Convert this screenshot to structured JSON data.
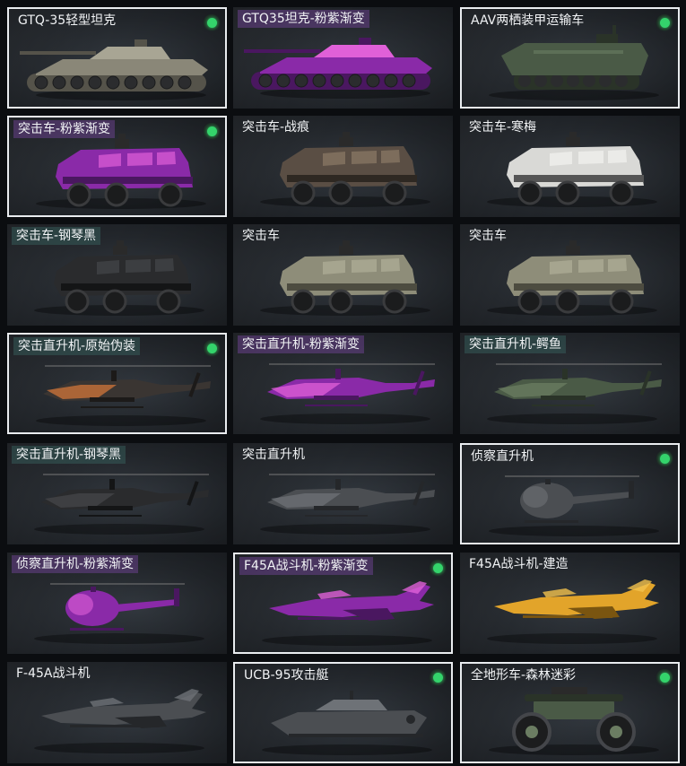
{
  "colors": {
    "accent_green": "#34d36b",
    "selected_border": "#e9ecef",
    "card_bg": "#2a2e33"
  },
  "items": [
    {
      "label": "GTQ-35轻型坦克",
      "type": "tank",
      "skin": "camo",
      "owned": true,
      "selected": true,
      "tint": "none"
    },
    {
      "label": "GTQ35坦克-粉紫渐变",
      "type": "tank",
      "skin": "pink",
      "owned": false,
      "selected": false,
      "tint": "purple"
    },
    {
      "label": "AAV两栖装甲运输车",
      "type": "aav",
      "skin": "green",
      "owned": true,
      "selected": true,
      "tint": "none"
    },
    {
      "label": "突击车-粉紫渐变",
      "type": "car",
      "skin": "pink",
      "owned": true,
      "selected": true,
      "tint": "purple"
    },
    {
      "label": "突击车-战痕",
      "type": "car",
      "skin": "battle",
      "owned": false,
      "selected": false,
      "tint": "none"
    },
    {
      "label": "突击车-寒梅",
      "type": "car",
      "skin": "white",
      "owned": false,
      "selected": false,
      "tint": "none"
    },
    {
      "label": "突击车-钢琴黑",
      "type": "car",
      "skin": "black",
      "owned": false,
      "selected": false,
      "tint": "teal"
    },
    {
      "label": "突击车",
      "type": "car",
      "skin": "olive",
      "owned": false,
      "selected": false,
      "tint": "none"
    },
    {
      "label": "突击车",
      "type": "car",
      "skin": "olive",
      "owned": false,
      "selected": false,
      "tint": "none"
    },
    {
      "label": "突击直升机-原始伪装",
      "type": "heli",
      "skin": "orange",
      "owned": true,
      "selected": true,
      "tint": "teal"
    },
    {
      "label": "突击直升机-粉紫渐变",
      "type": "heli",
      "skin": "pink",
      "owned": false,
      "selected": false,
      "tint": "purple"
    },
    {
      "label": "突击直升机-鳄鱼",
      "type": "heli",
      "skin": "green",
      "owned": false,
      "selected": false,
      "tint": "teal"
    },
    {
      "label": "突击直升机-钢琴黑",
      "type": "heli",
      "skin": "black",
      "owned": false,
      "selected": false,
      "tint": "teal"
    },
    {
      "label": "突击直升机",
      "type": "heli",
      "skin": "gray",
      "owned": false,
      "selected": false,
      "tint": "none"
    },
    {
      "label": "侦察直升机",
      "type": "scout",
      "skin": "gray",
      "owned": true,
      "selected": true,
      "tint": "none"
    },
    {
      "label": "侦察直升机-粉紫渐变",
      "type": "scout",
      "skin": "pink",
      "owned": false,
      "selected": false,
      "tint": "purple"
    },
    {
      "label": "F45A战斗机-粉紫渐变",
      "type": "jet",
      "skin": "pink",
      "owned": true,
      "selected": true,
      "tint": "purple"
    },
    {
      "label": "F45A战斗机-建造",
      "type": "jet",
      "skin": "yellow",
      "owned": false,
      "selected": false,
      "tint": "none"
    },
    {
      "label": "F-45A战斗机",
      "type": "jet",
      "skin": "gray",
      "owned": false,
      "selected": false,
      "tint": "none"
    },
    {
      "label": "UCB-95攻击艇",
      "type": "boat",
      "skin": "gray",
      "owned": true,
      "selected": true,
      "tint": "none"
    },
    {
      "label": "全地形车-森林迷彩",
      "type": "atv",
      "skin": "green",
      "owned": true,
      "selected": true,
      "tint": "none"
    }
  ]
}
